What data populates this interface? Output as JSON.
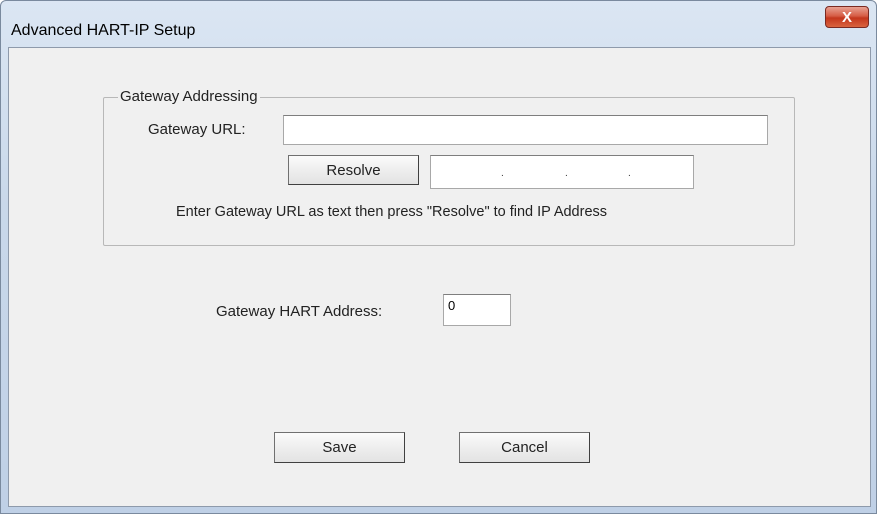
{
  "window": {
    "title": "Advanced HART-IP Setup",
    "close_glyph": "X"
  },
  "gateway_addressing": {
    "group_label": "Gateway Addressing",
    "url_label": "Gateway URL:",
    "url_value": "",
    "resolve_label": "Resolve",
    "ip_address_octets": [
      "",
      "",
      "",
      ""
    ],
    "ip_separators": [
      ".",
      ".",
      "."
    ],
    "hint": "Enter Gateway URL as text then press \"Resolve\" to find IP Address"
  },
  "hart_address": {
    "label": "Gateway HART Address:",
    "value": "0"
  },
  "buttons": {
    "save_label": "Save",
    "cancel_label": "Cancel"
  }
}
